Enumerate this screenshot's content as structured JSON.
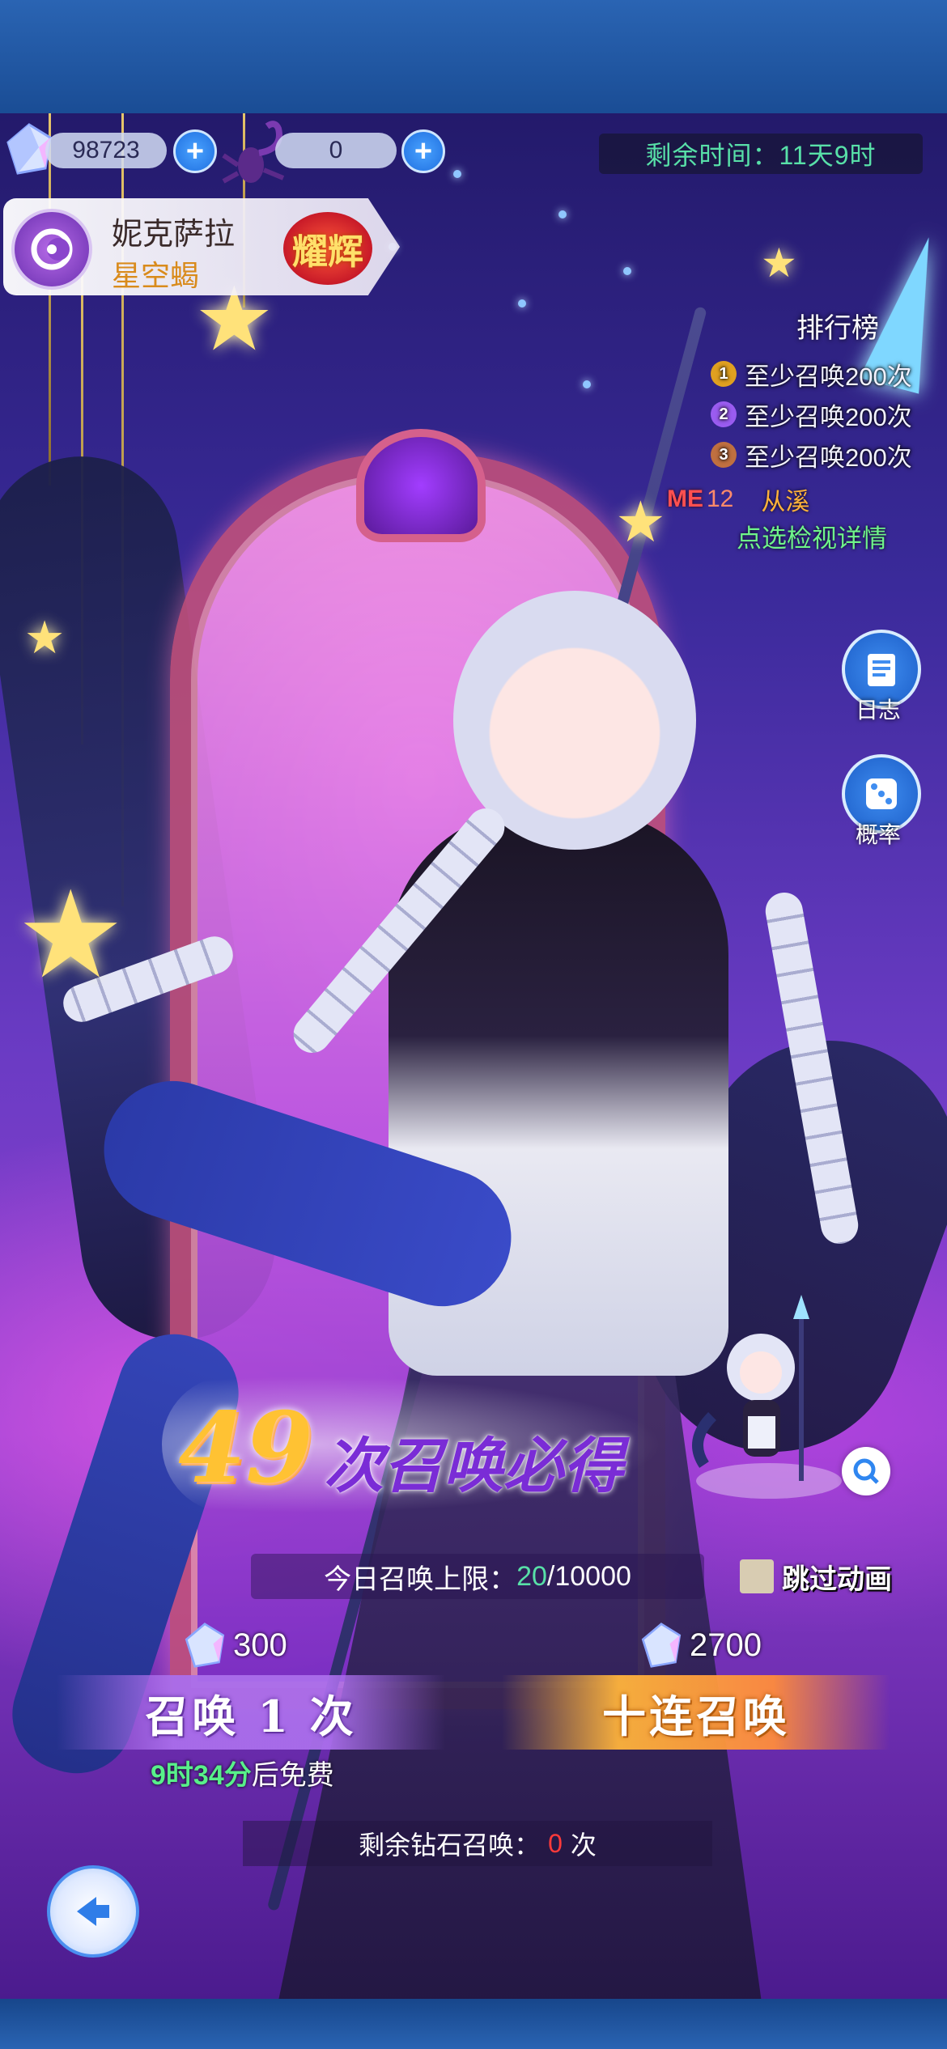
{
  "resources": {
    "gems": "98723",
    "scorpion_tokens": "0"
  },
  "event_timer": "剩余时间：11天9时",
  "hero": {
    "name": "妮克萨拉",
    "title": "星空蝎",
    "rank_badge": "耀辉"
  },
  "leaderboard": {
    "title": "排行榜",
    "rows": [
      {
        "medal": "1",
        "text": "至少召唤200次",
        "color": "#e0a020"
      },
      {
        "medal": "2",
        "text": "至少召唤200次",
        "color": "#9a5cf0"
      },
      {
        "medal": "3",
        "text": "至少召唤200次",
        "color": "#c07040"
      }
    ],
    "me": {
      "tag": "ME",
      "rank": "12",
      "name": "从溪"
    },
    "detail_link": "点选检视详情"
  },
  "side_buttons": {
    "log": "日志",
    "rate": "概率"
  },
  "pity": {
    "count": "49",
    "text": "次召唤必得"
  },
  "daily_limit": {
    "label": "今日召唤上限：",
    "used": "20",
    "max": "/10000"
  },
  "skip_animation": "跳过动画",
  "single_pull": {
    "cost": "300",
    "label": "召唤 1 次",
    "free_time": "9时34分",
    "free_suffix": "后免费"
  },
  "ten_pull": {
    "cost": "2700",
    "label": "十连召唤"
  },
  "remaining_diamond": {
    "prefix": "剩余钻石召唤：",
    "count": "0",
    "suffix": "次"
  },
  "colors": {
    "accent_green": "#58e0a8",
    "accent_gold": "#ffc233",
    "accent_purple": "#7a2cd6"
  }
}
